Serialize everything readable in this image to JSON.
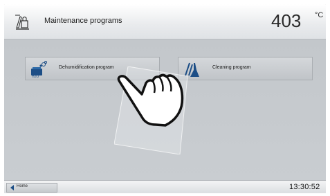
{
  "header": {
    "title": "Maintenance programs",
    "temperature": "403",
    "temperature_unit": "°C",
    "icon": "maintenance-pen-icon"
  },
  "programs": [
    {
      "label": "Dehumidification program",
      "icon": "dehumidification-icon"
    },
    {
      "label": "Cleaning program",
      "icon": "cleaning-broom-icon"
    }
  ],
  "footer": {
    "home_label": "Home",
    "clock": "13:30:52"
  },
  "overlay": {
    "icon": "pointing-hand-icon"
  },
  "colors": {
    "background": "#c5c9cd",
    "accent_blue": "#1d4e86"
  }
}
